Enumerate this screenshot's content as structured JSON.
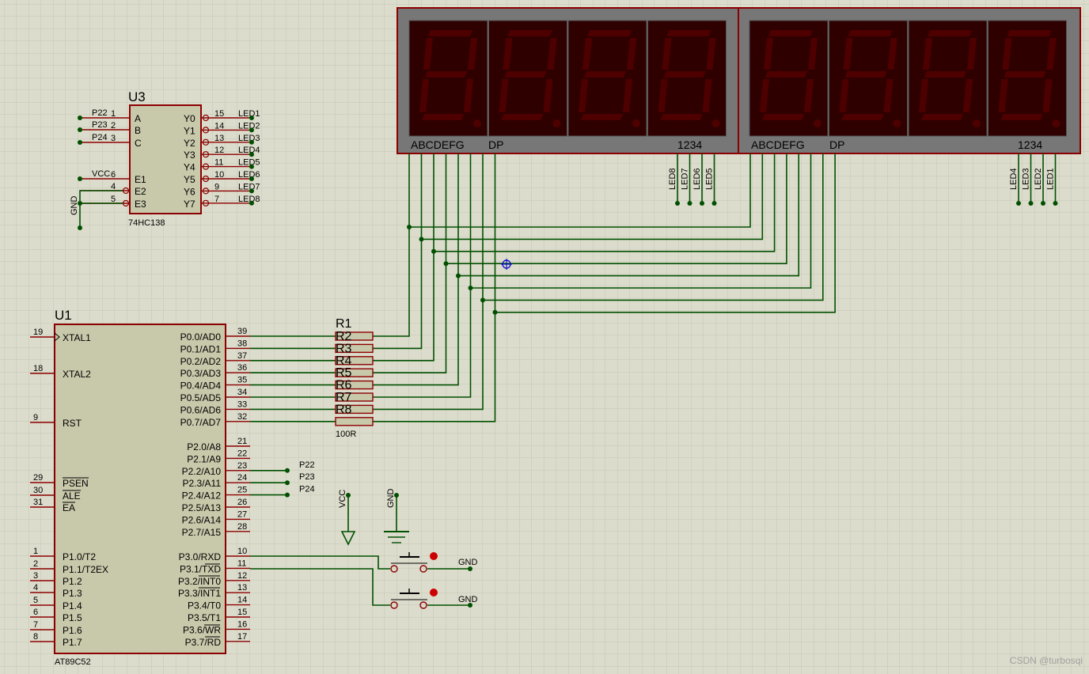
{
  "u3": {
    "ref": "U3",
    "type": "74HC138",
    "left_pins": [
      {
        "num": "1",
        "name": "A",
        "net": "P22"
      },
      {
        "num": "2",
        "name": "B",
        "net": "P23"
      },
      {
        "num": "3",
        "name": "C",
        "net": "P24"
      },
      {
        "num": "6",
        "name": "E1",
        "net": "VCC"
      },
      {
        "num": "4",
        "name": "E2",
        "net": ""
      },
      {
        "num": "5",
        "name": "E3",
        "net": ""
      }
    ],
    "gnd_label": "GND",
    "right_pins": [
      {
        "num": "15",
        "name": "Y0",
        "net": "LED1"
      },
      {
        "num": "14",
        "name": "Y1",
        "net": "LED2"
      },
      {
        "num": "13",
        "name": "Y2",
        "net": "LED3"
      },
      {
        "num": "12",
        "name": "Y3",
        "net": "LED4"
      },
      {
        "num": "11",
        "name": "Y4",
        "net": "LED5"
      },
      {
        "num": "10",
        "name": "Y5",
        "net": "LED6"
      },
      {
        "num": "9",
        "name": "Y6",
        "net": "LED7"
      },
      {
        "num": "7",
        "name": "Y7",
        "net": "LED8"
      }
    ]
  },
  "display": {
    "left": {
      "seg_label": "ABCDEFG",
      "dp_label": "DP",
      "digit_label": "1234",
      "nets": [
        "LED8",
        "LED7",
        "LED6",
        "LED5"
      ]
    },
    "right": {
      "seg_label": "ABCDEFG",
      "dp_label": "DP",
      "digit_label": "1234",
      "nets": [
        "LED4",
        "LED3",
        "LED2",
        "LED1"
      ]
    }
  },
  "resistors": {
    "refs": [
      "R1",
      "R2",
      "R3",
      "R4",
      "R5",
      "R6",
      "R7",
      "R8"
    ],
    "value": "100R"
  },
  "u1": {
    "ref": "U1",
    "type": "AT89C52",
    "left_pins": [
      {
        "num": "19",
        "name": "XTAL1"
      },
      {
        "num": "18",
        "name": "XTAL2"
      },
      {
        "num": "9",
        "name": "RST"
      },
      {
        "num": "29",
        "name": "PSEN"
      },
      {
        "num": "30",
        "name": "ALE"
      },
      {
        "num": "31",
        "name": "EA"
      },
      {
        "num": "1",
        "name": "P1.0/T2"
      },
      {
        "num": "2",
        "name": "P1.1/T2EX"
      },
      {
        "num": "3",
        "name": "P1.2"
      },
      {
        "num": "4",
        "name": "P1.3"
      },
      {
        "num": "5",
        "name": "P1.4"
      },
      {
        "num": "6",
        "name": "P1.5"
      },
      {
        "num": "7",
        "name": "P1.6"
      },
      {
        "num": "8",
        "name": "P1.7"
      }
    ],
    "right_pins": [
      {
        "num": "39",
        "name": "P0.0/AD0"
      },
      {
        "num": "38",
        "name": "P0.1/AD1"
      },
      {
        "num": "37",
        "name": "P0.2/AD2"
      },
      {
        "num": "36",
        "name": "P0.3/AD3"
      },
      {
        "num": "35",
        "name": "P0.4/AD4"
      },
      {
        "num": "34",
        "name": "P0.5/AD5"
      },
      {
        "num": "33",
        "name": "P0.6/AD6"
      },
      {
        "num": "32",
        "name": "P0.7/AD7"
      },
      {
        "num": "21",
        "name": "P2.0/A8"
      },
      {
        "num": "22",
        "name": "P2.1/A9"
      },
      {
        "num": "23",
        "name": "P2.2/A10",
        "net": "P22"
      },
      {
        "num": "24",
        "name": "P2.3/A11",
        "net": "P23"
      },
      {
        "num": "25",
        "name": "P2.4/A12",
        "net": "P24"
      },
      {
        "num": "26",
        "name": "P2.5/A13"
      },
      {
        "num": "27",
        "name": "P2.6/A14"
      },
      {
        "num": "28",
        "name": "P2.7/A15"
      },
      {
        "num": "10",
        "name": "P3.0/RXD"
      },
      {
        "num": "11",
        "name": "P3.1/TXD"
      },
      {
        "num": "12",
        "name": "P3.2/INT0"
      },
      {
        "num": "13",
        "name": "P3.3/INT1"
      },
      {
        "num": "14",
        "name": "P3.4/T0"
      },
      {
        "num": "15",
        "name": "P3.5/T1"
      },
      {
        "num": "16",
        "name": "P3.6/WR"
      },
      {
        "num": "17",
        "name": "P3.7/RD"
      }
    ]
  },
  "power": {
    "vcc": "VCC",
    "gnd": "GND",
    "button_gnd_1": "GND",
    "button_gnd_2": "GND"
  },
  "watermark": "CSDN @turbosqi",
  "colors": {
    "background": "#dcdccc",
    "grid": "#c6c6b6",
    "wire": "#005000",
    "pin": "#8b0000",
    "chip_body": "#c8c8ab",
    "display_frame": "#777777",
    "display_digit": "#2e0000",
    "segment_off": "#4e0000",
    "marker": "#0000cc"
  }
}
